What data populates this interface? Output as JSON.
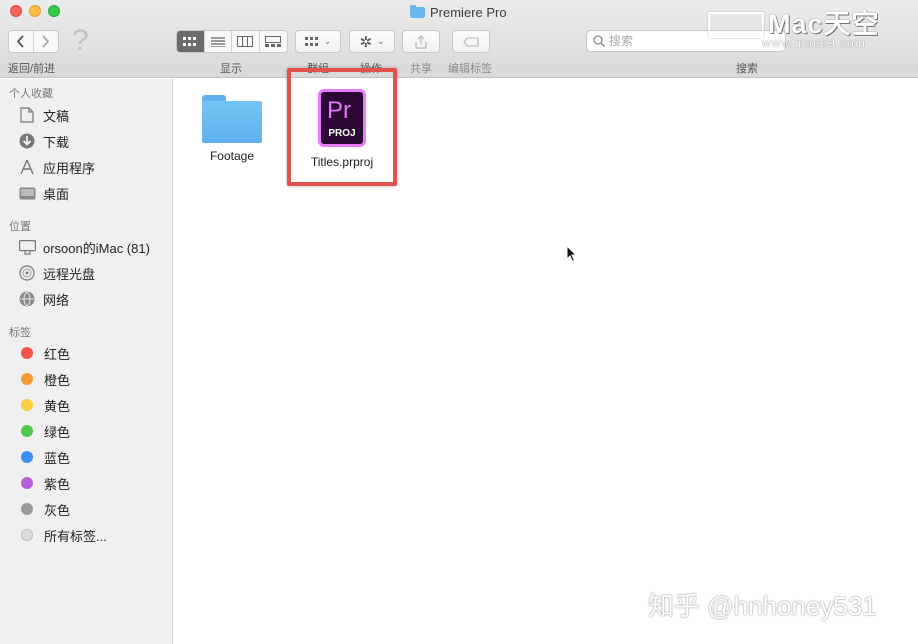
{
  "window": {
    "title": "Premiere Pro"
  },
  "toolbar": {
    "nav_label": "返回/前进",
    "view_label": "显示",
    "group_label": "群组",
    "action_label": "操作",
    "share_label": "共享",
    "tags_label": "编辑标签",
    "search_label": "搜索",
    "search_placeholder": "搜索"
  },
  "sidebar": {
    "favorites_header": "个人收藏",
    "favorites": [
      {
        "label": "文稿",
        "icon": "document-icon"
      },
      {
        "label": "下载",
        "icon": "download-icon"
      },
      {
        "label": "应用程序",
        "icon": "applications-icon"
      },
      {
        "label": "桌面",
        "icon": "desktop-icon"
      }
    ],
    "locations_header": "位置",
    "locations": [
      {
        "label": "orsoon的iMac (81)",
        "icon": "imac-icon"
      },
      {
        "label": "远程光盘",
        "icon": "disc-icon"
      },
      {
        "label": "网络",
        "icon": "network-icon"
      }
    ],
    "tags_header": "标签",
    "tags": [
      {
        "label": "红色",
        "color": "#f0524c"
      },
      {
        "label": "橙色",
        "color": "#f69a38"
      },
      {
        "label": "黄色",
        "color": "#f8cd3e"
      },
      {
        "label": "绿色",
        "color": "#4fc94c"
      },
      {
        "label": "蓝色",
        "color": "#3d8ef0"
      },
      {
        "label": "紫色",
        "color": "#b65fd8"
      },
      {
        "label": "灰色",
        "color": "#9a9a9a"
      },
      {
        "label": "所有标签...",
        "color": "#dcdcdc"
      }
    ]
  },
  "files": [
    {
      "name": "Footage",
      "kind": "folder"
    },
    {
      "name": "Titles.prproj",
      "kind": "premiere-project",
      "icon_text": "Pr",
      "icon_subtext": "PROJ",
      "selected_highlight": true
    }
  ],
  "watermarks": {
    "site_big": "Mac天空",
    "site_small": "www.mac69.com",
    "zhihu": "知乎 @hnhoney531"
  },
  "colors": {
    "highlight": "#e1524c",
    "folder": "#5fb2ee",
    "premiere_accent": "#e77cff",
    "premiere_bg": "#2a0833"
  }
}
